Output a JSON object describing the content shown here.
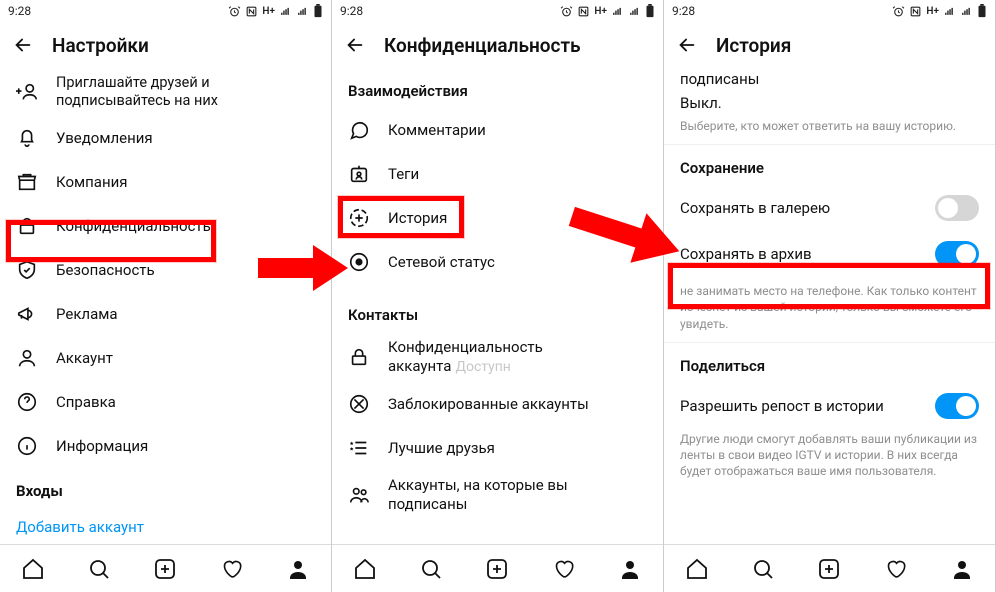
{
  "status": {
    "time": "9:28",
    "net": "H+"
  },
  "screen1": {
    "title": "Настройки",
    "items": [
      {
        "label": "Приглашайте друзей и подписывайтесь на них"
      },
      {
        "label": "Уведомления"
      },
      {
        "label": "Компания"
      },
      {
        "label": "Конфиденциальность"
      },
      {
        "label": "Безопасность"
      },
      {
        "label": "Реклама"
      },
      {
        "label": "Аккаунт"
      },
      {
        "label": "Справка"
      },
      {
        "label": "Информация"
      }
    ],
    "logins_header": "Входы",
    "add_account": "Добавить аккаунт"
  },
  "screen2": {
    "title": "Конфиденциальность",
    "section_interactions": "Взаимодействия",
    "items_a": [
      {
        "label": "Комментарии"
      },
      {
        "label": "Теги"
      },
      {
        "label": "История"
      },
      {
        "label": "Сетевой статус"
      }
    ],
    "section_contacts": "Контакты",
    "items_b": [
      {
        "label": "Конфиденциальность аккаунта",
        "suffix": "Доступн"
      },
      {
        "label": "Заблокированные аккаунты"
      },
      {
        "label": "Лучшие друзья"
      },
      {
        "label": "Аккаунты, на которые вы подписаны"
      }
    ]
  },
  "screen3": {
    "title": "История",
    "partial_top": "подписаны",
    "partial_value": "Выкл.",
    "helper1": "Выберите, кто может ответить на вашу историю.",
    "section_save": "Сохранение",
    "save_gallery": "Сохранять в галерею",
    "save_archive": "Сохранять в архив",
    "helper2": "не занимать место на телефоне. Как только контент исчезнет из вашей истории, только вы сможете его увидеть.",
    "section_share": "Поделиться",
    "allow_repost": "Разрешить репост в истории",
    "helper3": "Другие люди смогут добавлять ваши публикации из ленты в свои видео IGTV и истории. В них всегда будет отображаться ваше имя пользователя."
  }
}
